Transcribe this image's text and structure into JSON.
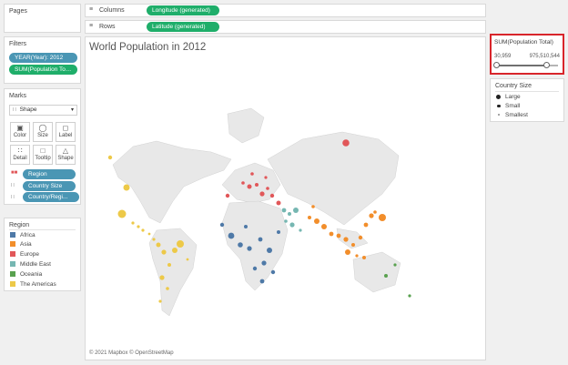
{
  "pages": {
    "title": "Pages"
  },
  "filters": {
    "title": "Filters",
    "items": [
      "YEAR(Year): 2012",
      "SUM(Population Tot..."
    ]
  },
  "marks": {
    "title": "Marks",
    "mark_type": "Shape",
    "buttons": [
      "Color",
      "Size",
      "Label",
      "Detail",
      "Tooltip",
      "Shape"
    ],
    "fields": [
      "Region",
      "Country Size",
      "Country/Regi..."
    ]
  },
  "region_legend": {
    "title": "Region",
    "items": [
      {
        "label": "Africa",
        "color": "#4e79a7"
      },
      {
        "label": "Asia",
        "color": "#f28e2b"
      },
      {
        "label": "Europe",
        "color": "#e15759"
      },
      {
        "label": "Middle East",
        "color": "#76b7b2"
      },
      {
        "label": "Oceania",
        "color": "#59a14f"
      },
      {
        "label": "The Americas",
        "color": "#edc948"
      }
    ]
  },
  "shelves": {
    "columns_label": "Columns",
    "columns_pill": "Longitude (generated)",
    "rows_label": "Rows",
    "rows_pill": "Latitude (generated)"
  },
  "viz": {
    "title": "World Population in 2012",
    "attribution": "© 2021 Mapbox © OpenStreetMap"
  },
  "population_filter": {
    "title": "SUM(Population Total)",
    "min": "30,959",
    "max": "975,510,544"
  },
  "size_legend": {
    "title": "Country Size",
    "items": [
      "Large",
      "Small",
      "Smallest"
    ]
  }
}
